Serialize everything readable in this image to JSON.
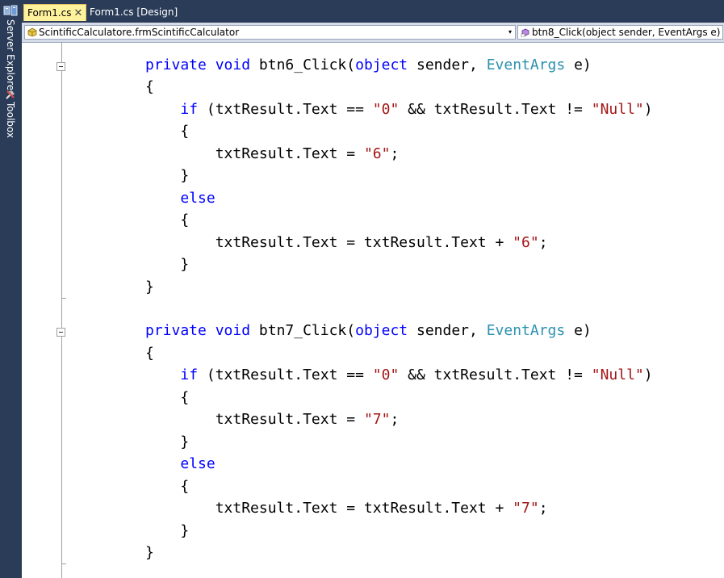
{
  "sidebar": {
    "tabs": [
      {
        "label": "Server Explorer",
        "icon": "server-explorer-icon"
      },
      {
        "label": "Toolbox",
        "icon": "toolbox-icon"
      }
    ]
  },
  "tabs": {
    "active": {
      "label": "Form1.cs",
      "close": "✕"
    },
    "inactive": {
      "label": "Form1.cs [Design]"
    }
  },
  "navbar": {
    "class_combo": "ScintificCalculatore.frmScintificCalculator",
    "member_combo": "btn8_Click(object sender, EventArgs e)",
    "dropdown_glyph": "▾"
  },
  "colors": {
    "keyword": "#0000ff",
    "type": "#2b91af",
    "string": "#a31515",
    "frame": "#2b3c59",
    "active_tab": "#fff29d"
  },
  "code": {
    "m1": {
      "private": "private",
      "void": "void",
      "name": " btn6_Click(",
      "object": "object",
      "sender": " sender, ",
      "eventargs": "EventArgs",
      "param": " e)",
      "open": "{",
      "if": "if",
      "cond_a": " (txtResult.Text == ",
      "zero": "\"0\"",
      "cond_b": " && txtResult.Text != ",
      "null": "\"Null\"",
      "cond_c": ")",
      "open2": "{",
      "assign1": "txtResult.Text = ",
      "val1": "\"6\"",
      "semi1": ";",
      "close2": "}",
      "else": "else",
      "open3": "{",
      "assign2": "txtResult.Text = txtResult.Text + ",
      "val2": "\"6\"",
      "semi2": ";",
      "close3": "}",
      "close": "}"
    },
    "m2": {
      "private": "private",
      "void": "void",
      "name": " btn7_Click(",
      "object": "object",
      "sender": " sender, ",
      "eventargs": "EventArgs",
      "param": " e)",
      "open": "{",
      "if": "if",
      "cond_a": " (txtResult.Text == ",
      "zero": "\"0\"",
      "cond_b": " && txtResult.Text != ",
      "null": "\"Null\"",
      "cond_c": ")",
      "open2": "{",
      "assign1": "txtResult.Text = ",
      "val1": "\"7\"",
      "semi1": ";",
      "close2": "}",
      "else": "else",
      "open3": "{",
      "assign2": "txtResult.Text = txtResult.Text + ",
      "val2": "\"7\"",
      "semi2": ";",
      "close3": "}",
      "close": "}"
    }
  }
}
